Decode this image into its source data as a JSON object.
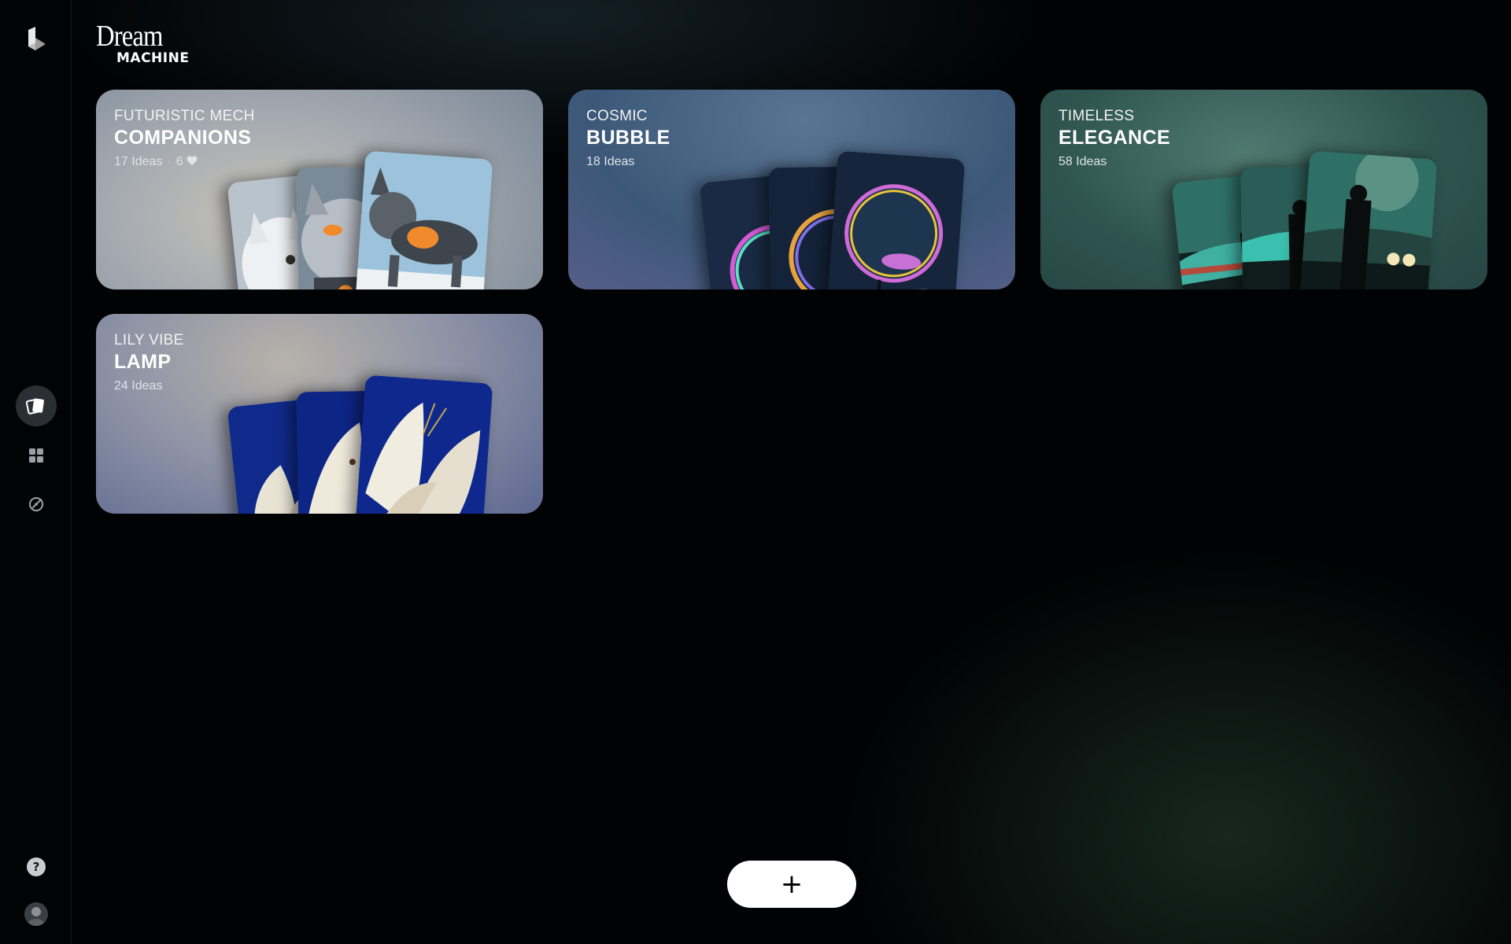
{
  "brand": {
    "line1": "Dream",
    "line2": "MACHINE"
  },
  "sidebar": {
    "items": [
      {
        "name": "boards",
        "icon": "cards-icon",
        "active": true
      },
      {
        "name": "grid",
        "icon": "grid-icon",
        "active": false
      },
      {
        "name": "explore",
        "icon": "compass-icon",
        "active": false
      }
    ],
    "help_icon": "help-icon",
    "avatar_icon": "avatar"
  },
  "boards": [
    {
      "kicker": "FUTURISTIC MECH",
      "title": "COMPANIONS",
      "ideas": "17 Ideas",
      "likes": "6",
      "sep": "·",
      "theme": "mech"
    },
    {
      "kicker": "COSMIC",
      "title": "BUBBLE",
      "ideas": "18 Ideas",
      "theme": "bubble"
    },
    {
      "kicker": "TIMELESS",
      "title": "ELEGANCE",
      "ideas": "58 Ideas",
      "theme": "noir"
    },
    {
      "kicker": "LILY VIBE",
      "title": "LAMP",
      "ideas": "24 Ideas",
      "theme": "lily"
    }
  ],
  "add_button": {
    "label": "+"
  },
  "colors": {
    "mech_bg": "#9aa3aa",
    "bubble_bg": "#4f6f8c",
    "noir_bg": "#2f5a52",
    "lily_bg": "#7f8aa8",
    "accent_white": "#ffffff"
  }
}
